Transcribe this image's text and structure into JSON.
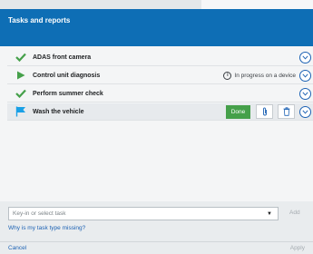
{
  "header": {
    "title": "Tasks and reports"
  },
  "tasks": [
    {
      "name": "ADAS front camera",
      "status_icon": "check-icon"
    },
    {
      "name": "Control unit diagnosis",
      "status_icon": "play-icon",
      "status_text": "In progress on a device"
    },
    {
      "name": "Perform summer check",
      "status_icon": "check-icon"
    },
    {
      "name": "Wash the vehicle",
      "status_icon": "flag-icon",
      "done_label": "Done"
    }
  ],
  "footer": {
    "select_placeholder": "Key-in or select task",
    "add_label": "Add",
    "missing_link": "Why is my task type missing?",
    "cancel_label": "Cancel",
    "apply_label": "Apply"
  },
  "colors": {
    "header_blue": "#0e6eb5",
    "check_green": "#45a04a",
    "flag_blue": "#19a0e6",
    "link_blue": "#1d62b4"
  }
}
